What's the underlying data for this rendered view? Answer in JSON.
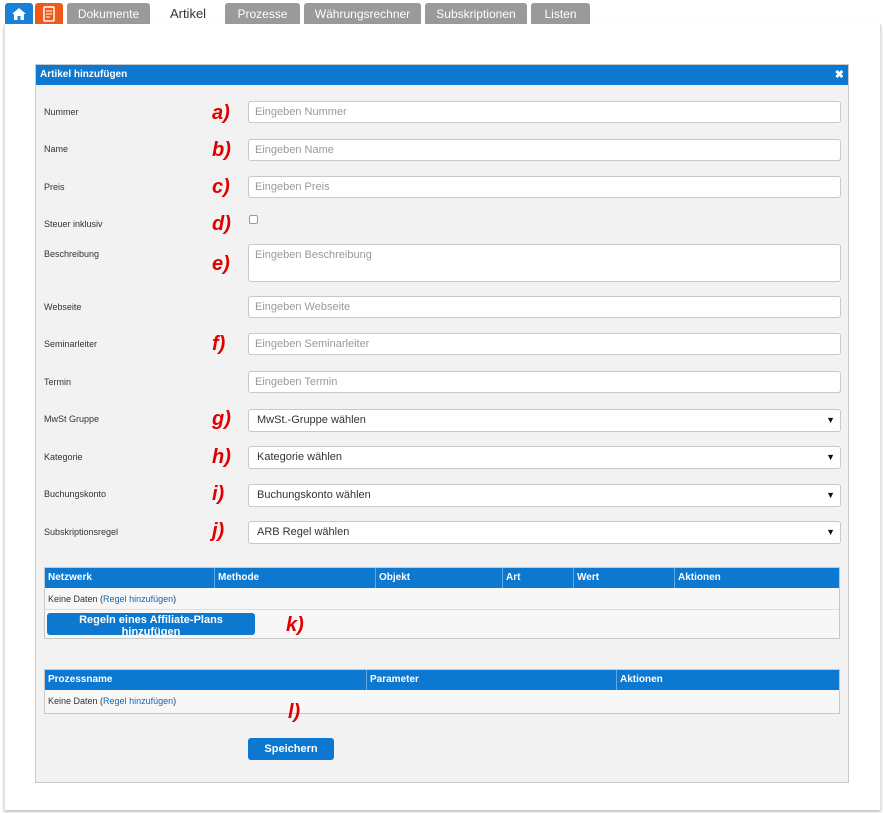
{
  "tabs": [
    "Dokumente",
    "Artikel",
    "Prozesse",
    "Währungsrechner",
    "Subskriptionen",
    "Listen"
  ],
  "panel": {
    "title": "Artikel hinzufügen",
    "close": "✖"
  },
  "fields": {
    "nummer": {
      "label": "Nummer",
      "placeholder": "Eingeben Nummer",
      "anno": "a)"
    },
    "name": {
      "label": "Name",
      "placeholder": "Eingeben Name",
      "anno": "b)"
    },
    "preis": {
      "label": "Preis",
      "placeholder": "Eingeben Preis",
      "anno": "c)"
    },
    "steuer": {
      "label": "Steuer inklusiv",
      "anno": "d)"
    },
    "beschreibung": {
      "label": "Beschreibung",
      "placeholder": "Eingeben Beschreibung",
      "anno": "e)"
    },
    "webseite": {
      "label": "Webseite",
      "placeholder": "Eingeben Webseite"
    },
    "seminarleiter": {
      "label": "Seminarleiter",
      "placeholder": "Eingeben Seminarleiter",
      "anno": "f)"
    },
    "termin": {
      "label": "Termin",
      "placeholder": "Eingeben Termin"
    },
    "mwst": {
      "label": "MwSt Gruppe",
      "value": "MwSt.-Gruppe wählen",
      "anno": "g)"
    },
    "kategorie": {
      "label": "Kategorie",
      "value": "Kategorie wählen",
      "anno": "h)"
    },
    "buchungskonto": {
      "label": "Buchungskonto",
      "value": "Buchungskonto wählen",
      "anno": "i)"
    },
    "subskription": {
      "label": "Subskriptionsregel",
      "value": "ARB Regel wählen",
      "anno": "j)"
    }
  },
  "affiliate_table": {
    "headers": [
      "Netzwerk",
      "Methode",
      "Objekt",
      "Art",
      "Wert",
      "Aktionen"
    ],
    "empty": "Keine Daten",
    "add_link": "Regel hinzufügen",
    "button": "Regeln eines Affiliate-Plans hinzufügen",
    "anno": "k)"
  },
  "process_table": {
    "headers": [
      "Prozessname",
      "Parameter",
      "Aktionen"
    ],
    "empty": "Keine Daten",
    "add_link": "Regel hinzufügen",
    "anno": "l)"
  },
  "save": "Speichern"
}
